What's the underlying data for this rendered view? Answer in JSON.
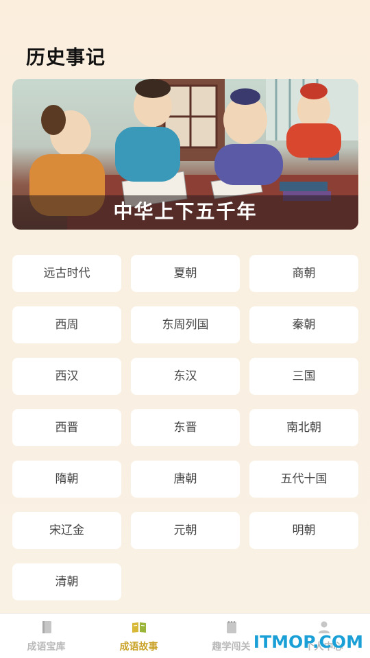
{
  "header": {
    "title": "历史事记"
  },
  "banner": {
    "caption": "中华上下五千年"
  },
  "eras": [
    "远古时代",
    "夏朝",
    "商朝",
    "西周",
    "东周列国",
    "秦朝",
    "西汉",
    "东汉",
    "三国",
    "西晋",
    "东晋",
    "南北朝",
    "隋朝",
    "唐朝",
    "五代十国",
    "宋辽金",
    "元朝",
    "明朝",
    "清朝"
  ],
  "tabbar": {
    "items": [
      {
        "label": "成语宝库",
        "icon": "book-icon",
        "active": false
      },
      {
        "label": "成语故事",
        "icon": "open-book-icon",
        "active": true
      },
      {
        "label": "趣学闯关",
        "icon": "notebook-icon",
        "active": false
      },
      {
        "label": "个人中心",
        "icon": "person-icon",
        "active": false
      }
    ]
  },
  "watermark": "ITMOP.COM",
  "colors": {
    "active_tab": "#c9a227",
    "inactive_tab": "#b9b9b9",
    "watermark": "#1aa0d6"
  }
}
